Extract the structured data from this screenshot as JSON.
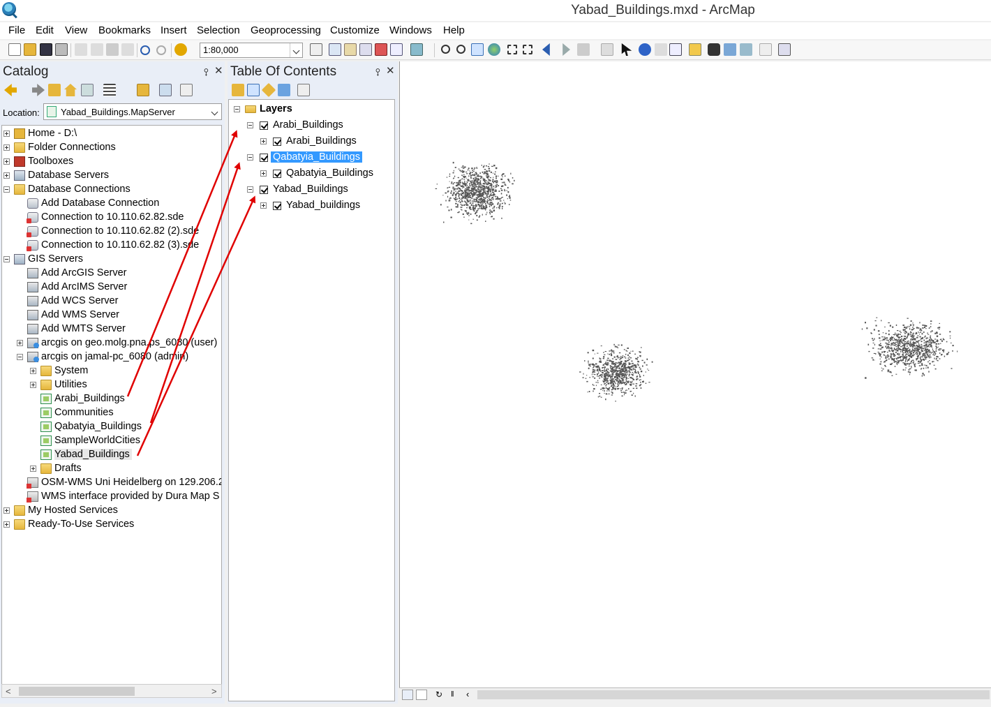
{
  "window": {
    "title": "Yabad_Buildings.mxd - ArcMap"
  },
  "menu": [
    "File",
    "Edit",
    "View",
    "Bookmarks",
    "Insert",
    "Selection",
    "Geoprocessing",
    "Customize",
    "Windows",
    "Help"
  ],
  "toolbar": {
    "scale": "1:80,000"
  },
  "catalog": {
    "title": "Catalog",
    "pin": "⯱",
    "close": "✕",
    "location_label": "Location:",
    "location_value": "Yabad_Buildings.MapServer",
    "tree": [
      {
        "label": "Home - D:\\",
        "icon": "home-folder-icon"
      },
      {
        "label": "Folder Connections",
        "icon": "folder-icon"
      },
      {
        "label": "Toolboxes",
        "icon": "toolbox-icon"
      },
      {
        "label": "Database Servers",
        "icon": "database-server-icon"
      },
      {
        "label": "Database Connections",
        "icon": "folder-icon"
      },
      {
        "label": "Add Database Connection",
        "icon": "add-database-icon"
      },
      {
        "label": "Connection to 10.110.62.82.sde",
        "icon": "sde-connection-icon"
      },
      {
        "label": "Connection to 10.110.62.82 (2).sde",
        "icon": "sde-connection-icon"
      },
      {
        "label": "Connection to 10.110.62.82 (3).sde",
        "icon": "sde-connection-icon"
      },
      {
        "label": "GIS Servers",
        "icon": "folder-icon"
      },
      {
        "label": "Add ArcGIS Server",
        "icon": "add-server-icon"
      },
      {
        "label": "Add ArcIMS Server",
        "icon": "add-server-icon"
      },
      {
        "label": "Add WCS Server",
        "icon": "add-server-icon"
      },
      {
        "label": "Add WMS Server",
        "icon": "add-server-icon"
      },
      {
        "label": "Add WMTS Server",
        "icon": "add-server-icon"
      },
      {
        "label": "arcgis on geo.molg.pna.ps_6080 (user)",
        "icon": "gis-server-icon"
      },
      {
        "label": "arcgis on jamal-pc_6080 (admin)",
        "icon": "gis-server-icon"
      },
      {
        "label": "System",
        "icon": "folder-icon"
      },
      {
        "label": "Utilities",
        "icon": "folder-icon"
      },
      {
        "label": "Arabi_Buildings",
        "icon": "map-service-icon"
      },
      {
        "label": "Communities",
        "icon": "map-service-icon"
      },
      {
        "label": "Qabatyia_Buildings",
        "icon": "map-service-icon"
      },
      {
        "label": "SampleWorldCities",
        "icon": "map-service-icon"
      },
      {
        "label": "Yabad_Buildings",
        "icon": "map-service-icon"
      },
      {
        "label": "Drafts",
        "icon": "folder-icon"
      },
      {
        "label": "OSM-WMS Uni Heidelberg on 129.206.2",
        "icon": "wms-service-icon"
      },
      {
        "label": "WMS interface provided by Dura Map S",
        "icon": "wms-service-icon"
      },
      {
        "label": "My Hosted Services",
        "icon": "folder-icon"
      },
      {
        "label": "Ready-To-Use Services",
        "icon": "folder-icon"
      }
    ],
    "scroll_left": "<",
    "scroll_right": ">"
  },
  "toc": {
    "title": "Table Of Contents",
    "pin": "⯱",
    "close": "✕",
    "root": "Layers",
    "layers": [
      {
        "group": "Arabi_Buildings",
        "child": "Arabi_Buildings",
        "selected": false
      },
      {
        "group": "Qabatyia_Buildings",
        "child": "Qabatyia_Buildings",
        "selected": true
      },
      {
        "group": "Yabad_Buildings",
        "child": "Yabad_buildings",
        "selected": false
      }
    ]
  },
  "colors": {
    "annotation_arrow": "#e00000",
    "selection": "#3399ff",
    "map_features": "#555555"
  }
}
